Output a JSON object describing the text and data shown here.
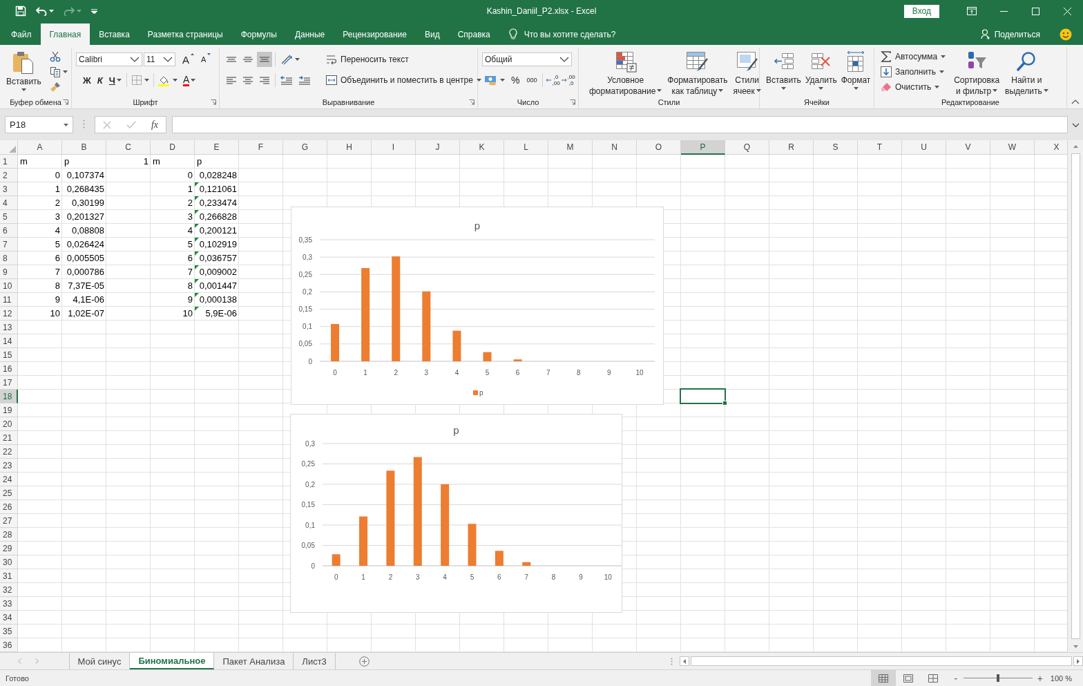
{
  "window": {
    "title": "Kashin_Daniil_P2.xlsx  -  Excel",
    "sign_in": "Вход"
  },
  "quick_access": {
    "redo": {
      "disabled": true
    }
  },
  "tabs": [
    {
      "label": "Файл",
      "selected": false
    },
    {
      "label": "Главная",
      "selected": true
    },
    {
      "label": "Вставка",
      "selected": false
    },
    {
      "label": "Разметка страницы",
      "selected": false
    },
    {
      "label": "Формулы",
      "selected": false
    },
    {
      "label": "Данные",
      "selected": false
    },
    {
      "label": "Рецензирование",
      "selected": false
    },
    {
      "label": "Вид",
      "selected": false
    },
    {
      "label": "Справка",
      "selected": false
    }
  ],
  "tell_me": {
    "placeholder": "Что вы хотите сделать?"
  },
  "share": "Поделиться",
  "ribbon": {
    "groups": [
      {
        "label": "Буфер обмена",
        "launcher": true,
        "controls": [
          {
            "kind": "big",
            "lines": [
              "Вставить"
            ],
            "menu": true
          }
        ]
      },
      {
        "label": "Шрифт",
        "launcher": true,
        "controls": [
          {
            "kind": "field",
            "value": "Calibri"
          },
          {
            "kind": "field",
            "value": "11"
          },
          {
            "kind": "glyph",
            "text": "A",
            "menu": false
          },
          {
            "kind": "glyph",
            "text": "A",
            "menu": false
          },
          {
            "kind": "glyph",
            "text": "Ж",
            "menu": false
          },
          {
            "kind": "glyph",
            "text": "К",
            "menu": false
          },
          {
            "kind": "glyph",
            "text": "Ч",
            "menu": true
          },
          {
            "kind": "glyph",
            "text": "A",
            "menu": true
          }
        ]
      },
      {
        "label": "Выравнивание",
        "launcher": true,
        "vertical_align": [
          {
            "selected": false
          },
          {
            "selected": false
          },
          {
            "selected": true
          }
        ],
        "horizontal_align": [
          {
            "selected": false
          },
          {
            "selected": false
          },
          {
            "selected": false
          }
        ],
        "controls": [
          {
            "kind": "small",
            "text": "Переносить текст",
            "menu": false
          },
          {
            "kind": "small",
            "text": "Объединить и поместить в центре",
            "menu": true
          }
        ]
      },
      {
        "label": "Число",
        "launcher": true,
        "controls": [
          {
            "kind": "field",
            "value": "Общий"
          },
          {
            "kind": "glyph",
            "text": "%",
            "menu": false
          },
          {
            "kind": "glyph",
            "text": "000",
            "menu": false
          },
          {
            "kind": "decimal",
            "lines": [
              ",0",
              ",00"
            ]
          },
          {
            "kind": "decimal",
            "lines": [
              ",00",
              ",0"
            ]
          }
        ]
      },
      {
        "label": "Стили",
        "launcher": false,
        "controls": [
          {
            "kind": "big",
            "lines": [
              "Условное",
              "форматирование"
            ],
            "menu": true
          },
          {
            "kind": "big",
            "lines": [
              "Форматировать",
              "как таблицу"
            ],
            "menu": true
          },
          {
            "kind": "big",
            "lines": [
              "Стили",
              "ячеек"
            ],
            "menu": true
          }
        ]
      },
      {
        "label": "Ячейки",
        "launcher": false,
        "controls": [
          {
            "kind": "big",
            "lines": [
              "Вставить"
            ],
            "menu": true
          },
          {
            "kind": "big",
            "lines": [
              "Удалить"
            ],
            "menu": true
          },
          {
            "kind": "big",
            "lines": [
              "Формат"
            ],
            "menu": true
          }
        ]
      },
      {
        "label": "Редактирование",
        "launcher": false,
        "controls": [
          {
            "kind": "small",
            "text": "Автосумма",
            "menu": true
          },
          {
            "kind": "small",
            "text": "Заполнить",
            "menu": true
          },
          {
            "kind": "small",
            "text": "Очистить",
            "menu": true
          },
          {
            "kind": "big",
            "lines": [
              "Сортировка",
              "и фильтр"
            ],
            "menu": true
          },
          {
            "kind": "big",
            "lines": [
              "Найти и",
              "выделить"
            ],
            "menu": true
          }
        ]
      }
    ]
  },
  "formula_bar": {
    "name_box": "P18",
    "function_label": "fx",
    "confirm_disabled": true
  },
  "sheet": {
    "columns": [
      {
        "label": "A",
        "selected": false
      },
      {
        "label": "B",
        "selected": false
      },
      {
        "label": "C",
        "selected": false
      },
      {
        "label": "D",
        "selected": false
      },
      {
        "label": "E",
        "selected": false
      },
      {
        "label": "F",
        "selected": false
      },
      {
        "label": "G",
        "selected": false
      },
      {
        "label": "H",
        "selected": false
      },
      {
        "label": "I",
        "selected": false
      },
      {
        "label": "J",
        "selected": false
      },
      {
        "label": "K",
        "selected": false
      },
      {
        "label": "L",
        "selected": false
      },
      {
        "label": "M",
        "selected": false
      },
      {
        "label": "N",
        "selected": false
      },
      {
        "label": "O",
        "selected": false
      },
      {
        "label": "P",
        "selected": true
      },
      {
        "label": "Q",
        "selected": false
      },
      {
        "label": "R",
        "selected": false
      },
      {
        "label": "S",
        "selected": false
      },
      {
        "label": "T",
        "selected": false
      },
      {
        "label": "U",
        "selected": false
      },
      {
        "label": "V",
        "selected": false
      },
      {
        "label": "W",
        "selected": false
      },
      {
        "label": "X",
        "selected": false
      }
    ],
    "rows": [
      {
        "label": "1",
        "selected": false,
        "cells": [
          {
            "kind": "text",
            "text": "m",
            "flagged": false
          },
          {
            "kind": "text",
            "text": "p",
            "flagged": false
          },
          {
            "kind": "number",
            "text": "1",
            "flagged": false
          },
          {
            "kind": "text",
            "text": "m",
            "flagged": false
          },
          {
            "kind": "text",
            "text": "p",
            "flagged": false
          }
        ]
      },
      {
        "label": "2",
        "selected": false,
        "cells": [
          {
            "kind": "number",
            "text": "0",
            "flagged": false
          },
          {
            "kind": "number",
            "text": "0,107374",
            "flagged": false
          },
          {
            "kind": "empty"
          },
          {
            "kind": "number",
            "text": "0",
            "flagged": false
          },
          {
            "kind": "number",
            "text": "0,028248",
            "flagged": false
          }
        ]
      },
      {
        "label": "3",
        "selected": false,
        "cells": [
          {
            "kind": "number",
            "text": "1",
            "flagged": false
          },
          {
            "kind": "number",
            "text": "0,268435",
            "flagged": false
          },
          {
            "kind": "empty"
          },
          {
            "kind": "number",
            "text": "1",
            "flagged": false
          },
          {
            "kind": "number",
            "text": "0,121061",
            "flagged": true
          }
        ]
      },
      {
        "label": "4",
        "selected": false,
        "cells": [
          {
            "kind": "number",
            "text": "2",
            "flagged": false
          },
          {
            "kind": "number",
            "text": "0,30199",
            "flagged": false
          },
          {
            "kind": "empty"
          },
          {
            "kind": "number",
            "text": "2",
            "flagged": false
          },
          {
            "kind": "number",
            "text": "0,233474",
            "flagged": true
          }
        ]
      },
      {
        "label": "5",
        "selected": false,
        "cells": [
          {
            "kind": "number",
            "text": "3",
            "flagged": false
          },
          {
            "kind": "number",
            "text": "0,201327",
            "flagged": false
          },
          {
            "kind": "empty"
          },
          {
            "kind": "number",
            "text": "3",
            "flagged": false
          },
          {
            "kind": "number",
            "text": "0,266828",
            "flagged": true
          }
        ]
      },
      {
        "label": "6",
        "selected": false,
        "cells": [
          {
            "kind": "number",
            "text": "4",
            "flagged": false
          },
          {
            "kind": "number",
            "text": "0,08808",
            "flagged": false
          },
          {
            "kind": "empty"
          },
          {
            "kind": "number",
            "text": "4",
            "flagged": false
          },
          {
            "kind": "number",
            "text": "0,200121",
            "flagged": true
          }
        ]
      },
      {
        "label": "7",
        "selected": false,
        "cells": [
          {
            "kind": "number",
            "text": "5",
            "flagged": false
          },
          {
            "kind": "number",
            "text": "0,026424",
            "flagged": false
          },
          {
            "kind": "empty"
          },
          {
            "kind": "number",
            "text": "5",
            "flagged": false
          },
          {
            "kind": "number",
            "text": "0,102919",
            "flagged": true
          }
        ]
      },
      {
        "label": "8",
        "selected": false,
        "cells": [
          {
            "kind": "number",
            "text": "6",
            "flagged": false
          },
          {
            "kind": "number",
            "text": "0,005505",
            "flagged": false
          },
          {
            "kind": "empty"
          },
          {
            "kind": "number",
            "text": "6",
            "flagged": false
          },
          {
            "kind": "number",
            "text": "0,036757",
            "flagged": true
          }
        ]
      },
      {
        "label": "9",
        "selected": false,
        "cells": [
          {
            "kind": "number",
            "text": "7",
            "flagged": false
          },
          {
            "kind": "number",
            "text": "0,000786",
            "flagged": false
          },
          {
            "kind": "empty"
          },
          {
            "kind": "number",
            "text": "7",
            "flagged": false
          },
          {
            "kind": "number",
            "text": "0,009002",
            "flagged": true
          }
        ]
      },
      {
        "label": "10",
        "selected": false,
        "cells": [
          {
            "kind": "number",
            "text": "8",
            "flagged": false
          },
          {
            "kind": "number",
            "text": "7,37E-05",
            "flagged": false
          },
          {
            "kind": "empty"
          },
          {
            "kind": "number",
            "text": "8",
            "flagged": false
          },
          {
            "kind": "number",
            "text": "0,001447",
            "flagged": true
          }
        ]
      },
      {
        "label": "11",
        "selected": false,
        "cells": [
          {
            "kind": "number",
            "text": "9",
            "flagged": false
          },
          {
            "kind": "number",
            "text": "4,1E-06",
            "flagged": false
          },
          {
            "kind": "empty"
          },
          {
            "kind": "number",
            "text": "9",
            "flagged": false
          },
          {
            "kind": "number",
            "text": "0,000138",
            "flagged": true
          }
        ]
      },
      {
        "label": "12",
        "selected": false,
        "cells": [
          {
            "kind": "number",
            "text": "10",
            "flagged": false
          },
          {
            "kind": "number",
            "text": "1,02E-07",
            "flagged": false
          },
          {
            "kind": "empty"
          },
          {
            "kind": "number",
            "text": "10",
            "flagged": false
          },
          {
            "kind": "number",
            "text": "5,9E-06",
            "flagged": true
          }
        ]
      },
      {
        "label": "13",
        "selected": false
      },
      {
        "label": "14",
        "selected": false
      },
      {
        "label": "15",
        "selected": false
      },
      {
        "label": "16",
        "selected": false
      },
      {
        "label": "17",
        "selected": false
      },
      {
        "label": "18",
        "selected": true
      },
      {
        "label": "19",
        "selected": false
      },
      {
        "label": "20",
        "selected": false
      },
      {
        "label": "21",
        "selected": false
      },
      {
        "label": "22",
        "selected": false
      },
      {
        "label": "23",
        "selected": false
      },
      {
        "label": "24",
        "selected": false
      },
      {
        "label": "25",
        "selected": false
      },
      {
        "label": "26",
        "selected": false
      },
      {
        "label": "27",
        "selected": false
      },
      {
        "label": "28",
        "selected": false
      },
      {
        "label": "29",
        "selected": false
      },
      {
        "label": "30",
        "selected": false
      },
      {
        "label": "31",
        "selected": false
      },
      {
        "label": "32",
        "selected": false
      },
      {
        "label": "33",
        "selected": false
      },
      {
        "label": "34",
        "selected": false
      },
      {
        "label": "35",
        "selected": false
      },
      {
        "label": "36",
        "selected": false
      }
    ],
    "charts": [
      {
        "chart_data": {
          "type": "bar",
          "title": "p",
          "categories": [
            "0",
            "1",
            "2",
            "3",
            "4",
            "5",
            "6",
            "7",
            "8",
            "9",
            "10"
          ],
          "series": [
            {
              "name": "p",
              "color": "#ed7d31",
              "values": [
                0.107374,
                0.268435,
                0.30199,
                0.201327,
                0.08808,
                0.026424,
                0.005505,
                0.000786,
                7.37e-05,
                4.1e-06,
                1.02e-07
              ]
            }
          ],
          "ylim": [
            0,
            0.35
          ],
          "yticks": [
            {
              "value": 0,
              "label": "0"
            },
            {
              "value": 0.05,
              "label": "0,05"
            },
            {
              "value": 0.1,
              "label": "0,1"
            },
            {
              "value": 0.15,
              "label": "0,15"
            },
            {
              "value": 0.2,
              "label": "0,2"
            },
            {
              "value": 0.25,
              "label": "0,25"
            },
            {
              "value": 0.3,
              "label": "0,3"
            },
            {
              "value": 0.35,
              "label": "0,35"
            }
          ],
          "grid": true
        },
        "legend": true
      },
      {
        "chart_data": {
          "type": "bar",
          "title": "p",
          "categories": [
            "0",
            "1",
            "2",
            "3",
            "4",
            "5",
            "6",
            "7",
            "8",
            "9",
            "10"
          ],
          "series": [
            {
              "color": "#ed7d31",
              "values": [
                0.028248,
                0.121061,
                0.233474,
                0.266828,
                0.200121,
                0.102919,
                0.036757,
                0.009002,
                0.001447,
                0.000138,
                5.9e-06
              ]
            }
          ],
          "ylim": [
            0,
            0.3
          ],
          "yticks": [
            {
              "value": 0,
              "label": "0"
            },
            {
              "value": 0.05,
              "label": "0,05"
            },
            {
              "value": 0.1,
              "label": "0,1"
            },
            {
              "value": 0.15,
              "label": "0,15"
            },
            {
              "value": 0.2,
              "label": "0,2"
            },
            {
              "value": 0.25,
              "label": "0,25"
            },
            {
              "value": 0.3,
              "label": "0,3"
            }
          ],
          "grid": true
        },
        "legend": false
      }
    ]
  },
  "sheet_tabs": [
    {
      "label": "Мой синус",
      "selected": false
    },
    {
      "label": "Биномиальное",
      "selected": true
    },
    {
      "label": "Пакет Анализа",
      "selected": false
    },
    {
      "label": "Лист3",
      "selected": false
    }
  ],
  "status_bar": {
    "text": "Готово",
    "views": [
      {
        "selected": true
      },
      {
        "selected": false
      },
      {
        "selected": false
      }
    ],
    "zoom": {
      "minus": "-",
      "plus": "+",
      "level": 0.5,
      "reading": "100 %"
    }
  }
}
